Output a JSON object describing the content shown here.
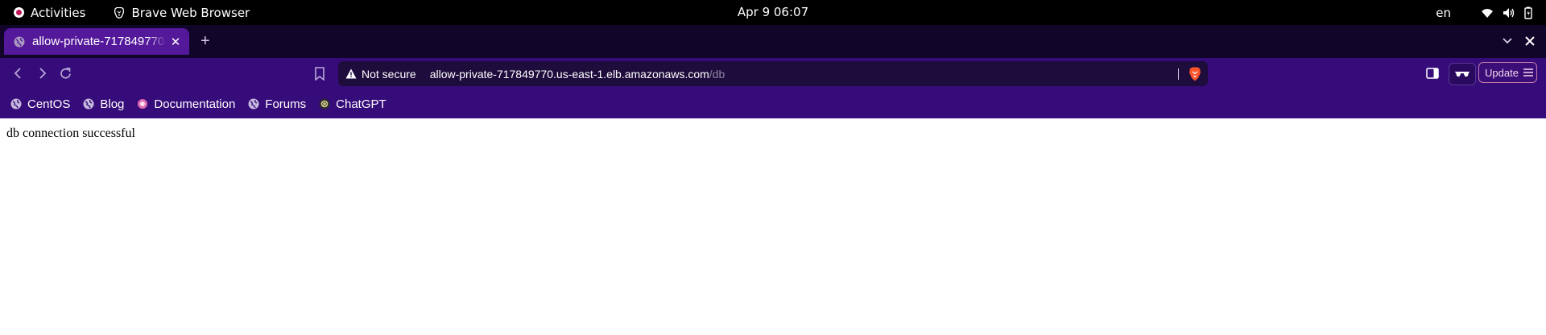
{
  "topbar": {
    "activities_label": "Activities",
    "app_name": "Brave Web Browser",
    "clock": "Apr 9  06:07",
    "language": "en",
    "icons": [
      "wifi-icon",
      "volume-icon",
      "battery-icon"
    ]
  },
  "tabs": [
    {
      "title": "allow-private-717849770",
      "icon": "globe-icon",
      "active": true
    }
  ],
  "tabstrip": {
    "new_tab_icon": "plus-icon",
    "tab_search_icon": "chevron-down-icon",
    "window_close_icon": "close-icon"
  },
  "toolbar": {
    "back_icon": "back-icon",
    "forward_icon": "forward-icon",
    "reload_icon": "reload-icon",
    "bookmark_icon": "bookmark-icon",
    "security_label": "Not secure",
    "url_host": "allow-private-717849770.us-east-1.elb.amazonaws.com",
    "url_path": "/db",
    "update_label": "Update"
  },
  "bookmarks": [
    {
      "label": "CentOS",
      "icon": "globe-icon"
    },
    {
      "label": "Blog",
      "icon": "globe-icon"
    },
    {
      "label": "Documentation",
      "icon": "flower-icon"
    },
    {
      "label": "Forums",
      "icon": "globe-icon"
    },
    {
      "label": "ChatGPT",
      "icon": "openai-icon"
    }
  ],
  "page": {
    "body_text": "db connection successful"
  },
  "colors": {
    "tab_active": "#54189a",
    "toolbar": "#360c7a",
    "tabstrip": "#12052a",
    "omnibox": "#1d0c3c",
    "brave_orange": "#fb542b"
  }
}
